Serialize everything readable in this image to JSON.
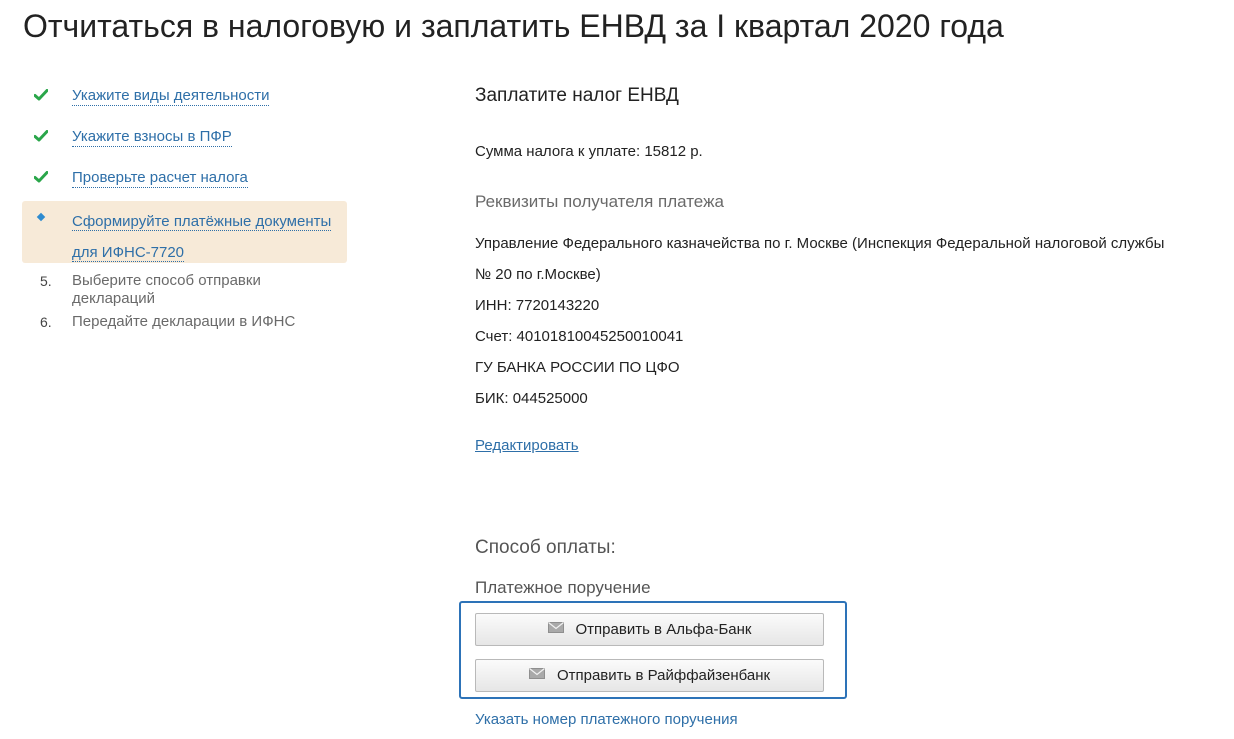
{
  "page": {
    "title": "Отчитаться в налоговую и заплатить ЕНВД за I квартал 2020 года"
  },
  "steps": [
    {
      "label": "Укажите виды деятельности",
      "state": "done"
    },
    {
      "label": "Укажите взносы в ПФР",
      "state": "done"
    },
    {
      "label": "Проверьте расчет налога",
      "state": "done"
    },
    {
      "label_line1": "Сформируйте платёжные документы",
      "label_line2": "для ИФНС-7720",
      "state": "current"
    },
    {
      "number": "5.",
      "label": "Выберите способ отправки деклараций",
      "state": "pending"
    },
    {
      "number": "6.",
      "label": "Передайте декларации в ИФНС",
      "state": "pending"
    }
  ],
  "main": {
    "title": "Заплатите налог ЕНВД",
    "tax_sum": "Сумма налога к уплате: 15812 р.",
    "requisites_heading": "Реквизиты получателя платежа",
    "requisites": {
      "recipient_line1": "Управление Федерального казначейства по г. Москве (Инспекция Федеральной налоговой службы",
      "recipient_line2": "№ 20 по г.Москве)",
      "inn": "ИНН: 7720143220",
      "account": "Счет: 40101810045250010041",
      "bank": "ГУ БАНКА РОССИИ ПО ЦФО",
      "bik": "БИК: 044525000"
    },
    "edit_link": "Редактировать",
    "payment_method_heading": "Способ оплаты:",
    "payment_order_label": "Платежное поручение",
    "buttons": {
      "alfa": "Отправить в Альфа-Банк",
      "raif": "Отправить в Райффайзенбанк"
    },
    "order_number_link": "Указать номер платежного поручения"
  },
  "colors": {
    "link": "#2e6fa8",
    "check": "#2aa64a",
    "active_bg": "#f7ead8",
    "highlight_border": "#2d73b8"
  },
  "icons": {
    "done": "check-icon",
    "current": "diamond-icon",
    "button": "envelope-icon"
  }
}
